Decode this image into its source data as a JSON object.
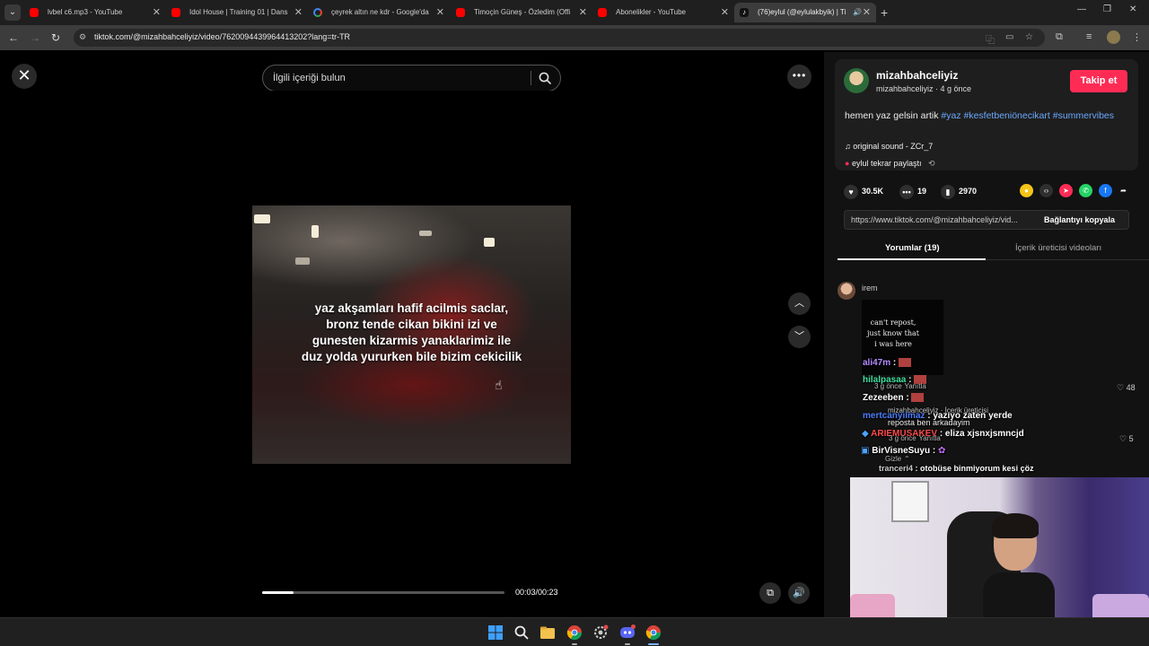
{
  "browser": {
    "tabs": [
      {
        "title": "lvbel c6.mp3 - YouTube",
        "favicon": "youtube-icon"
      },
      {
        "title": "Idol House | Training 01 | Dans",
        "favicon": "youtube-icon"
      },
      {
        "title": "çeyrek altın ne kdr - Google'da",
        "favicon": "google-icon"
      },
      {
        "title": "Timoçin Güneş - Özledim (Offi",
        "favicon": "youtube-icon"
      },
      {
        "title": "Abonelikler - YouTube",
        "favicon": "youtube-icon"
      },
      {
        "title": "(76)eylul (@eylulakbyik) | Ti",
        "favicon": "tiktok-icon",
        "active": true
      }
    ],
    "url": "tiktok.com/@mizahbahceliyiz/video/7620094439964413202?lang=tr-TR"
  },
  "video": {
    "search_placeholder": "İlgili içeriği bulun",
    "caption_lines": [
      "yaz akşamları hafif acilmis saclar,",
      "bronz tende cikan bikini izi ve",
      "gunesten kizarmis yanaklarimiz ile",
      "duz yolda yururken bile bizim cekicilik"
    ],
    "progress": 0.13,
    "time": "00:03/00:23"
  },
  "post": {
    "author": "mizahbahceliyiz",
    "author_sub": "mizahbahceliyiz · 4 g önce",
    "follow_label": "Takip et",
    "description_text": "hemen yaz gelsin artik ",
    "hashtags": [
      "#yaz",
      "#kesfetbeniönecikart",
      "#summervibes"
    ],
    "music": "original sound - ZCr_7",
    "repost": "eylul tekrar paylaştı",
    "likes": "30.5K",
    "comments": "19",
    "saves": "2970",
    "link": "https://www.tiktok.com/@mizahbahceliyiz/vid...",
    "copy_link": "Bağlantıyı kopyala",
    "tab_comments": "Yorumlar (19)",
    "tab_creator": "İçerik üreticisi videoları"
  },
  "comments": {
    "first_user": "irem",
    "image_text": [
      "can't repost,",
      "just know that",
      "i was here"
    ],
    "like_count_1": "48",
    "like_count_2": "5",
    "reply_meta_1": "3 g önce",
    "reply_label": "Yanıtla",
    "reply_meta_2": "3 g önce",
    "creator_reply": "mizahbahceliyiz · İçerik üreticisi",
    "creator_reply_text": "reposta ben arkadayim",
    "hide_label": "Gizle"
  },
  "stream_chat": [
    {
      "user": "ali47m",
      "text": ":",
      "color": "#b58cff"
    },
    {
      "user": "hilalpasaa",
      "text": ":",
      "color": "#40e0a0"
    },
    {
      "user": "Zezeeben",
      "text": ":",
      "color": "#ffffff"
    },
    {
      "user": "mertcanyilmaz",
      "text": ": yazıyo zaten yerde",
      "color": "#4d7dff"
    },
    {
      "user": "ARIEMUSAKEV",
      "text": ": eliza xjsnxjsmncjd",
      "color": "#ff4a4a"
    },
    {
      "user": "BirVisneSuyu",
      "text": ":",
      "color": "#ffffff"
    },
    {
      "user": "tranceri4",
      "text": ": otobüse binmiyorum kesi çöz",
      "color": "#cccccc"
    }
  ],
  "colors": {
    "accent": "#fe2c55",
    "hashtag": "#6aa9ff",
    "panel": "#121212"
  }
}
